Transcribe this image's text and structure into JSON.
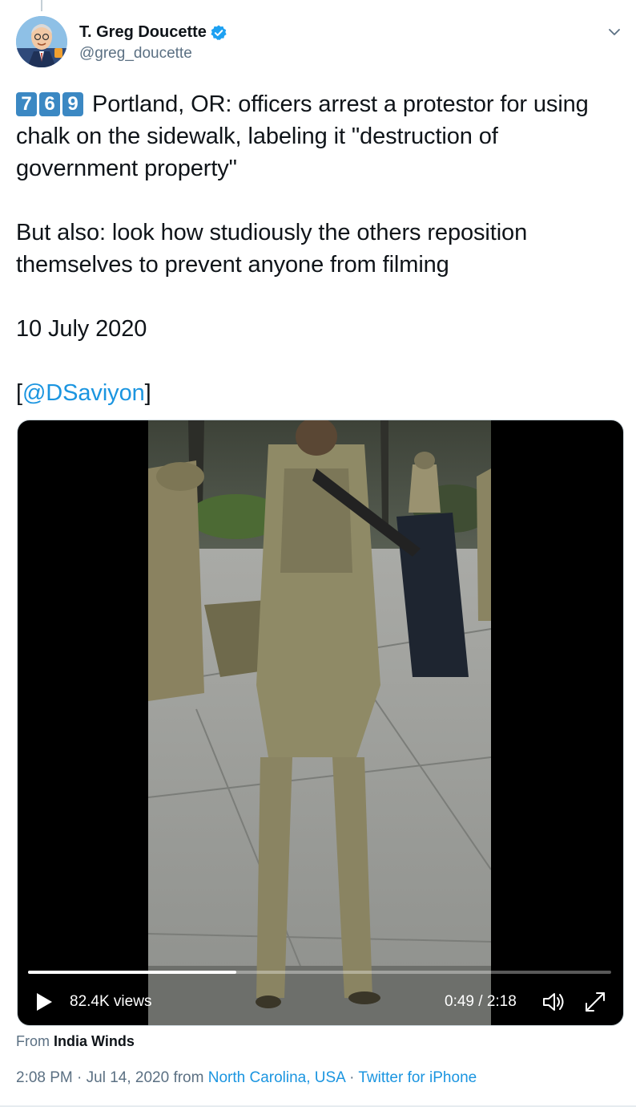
{
  "author": {
    "name": "T. Greg Doucette",
    "handle": "@greg_doucette",
    "verified": true,
    "avatar_icon": "cartoon-avatar-icon"
  },
  "tweet": {
    "keycaps": [
      "7",
      "6",
      "9"
    ],
    "line1": "Portland, OR: officers arrest a protestor for using chalk on the sidewalk, labeling it \"destruction of government property\"",
    "line2": "But also: look how studiously the others reposition themselves to prevent anyone from filming",
    "date_line": "10 July 2020",
    "credit_open": "[",
    "credit_mention": "@DSaviyon",
    "credit_close": "]"
  },
  "video": {
    "views": "82.4K views",
    "time": "0:49 / 2:18",
    "progress": 0.357
  },
  "source": {
    "prefix": "From",
    "name": "India Winds"
  },
  "meta": {
    "time": "2:08 PM · Jul 14, 2020 from",
    "location": "North Carolina, USA",
    "separator": "·",
    "client": "Twitter for iPhone"
  },
  "colors": {
    "link": "#1b95e0",
    "secondary_text": "#5b7083",
    "keycap": "#3b88c3"
  }
}
